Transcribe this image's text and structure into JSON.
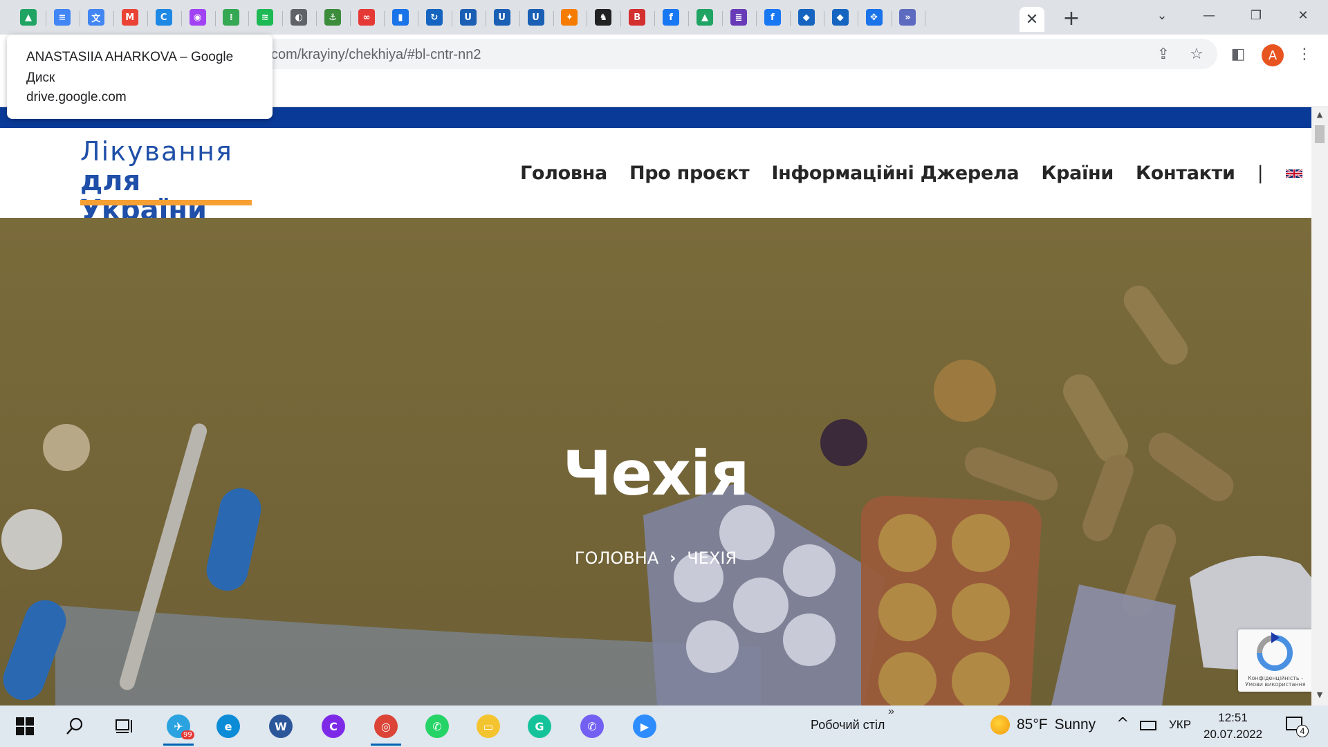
{
  "browser": {
    "tab_favicons": [
      {
        "icon": "google-drive-icon",
        "color": "#1fa463",
        "glyph": "▲"
      },
      {
        "icon": "google-docs-icon",
        "color": "#4285f4",
        "glyph": "≡"
      },
      {
        "icon": "google-translate-icon",
        "color": "#4285f4",
        "glyph": "文"
      },
      {
        "icon": "gmail-icon",
        "color": "#ea4335",
        "glyph": "M"
      },
      {
        "icon": "edge-refresh-icon",
        "color": "#1e88e5",
        "glyph": "C"
      },
      {
        "icon": "podcasts-icon",
        "color": "#a142f4",
        "glyph": "◉"
      },
      {
        "icon": "google-podcasts-icon",
        "color": "#34a853",
        "glyph": "⁞"
      },
      {
        "icon": "spotify-icon",
        "color": "#1db954",
        "glyph": "≋"
      },
      {
        "icon": "globe-icon",
        "color": "#5f6368",
        "glyph": "◐"
      },
      {
        "icon": "anchor-icon",
        "color": "#3c8c3c",
        "glyph": "⚓"
      },
      {
        "icon": "infinity-icon",
        "color": "#e53935",
        "glyph": "∞"
      },
      {
        "icon": "notebook-icon",
        "color": "#1a73e8",
        "glyph": "▮"
      },
      {
        "icon": "sync-icon",
        "color": "#1565c0",
        "glyph": "↻"
      },
      {
        "icon": "u-icon-1",
        "color": "#1a5fb4",
        "glyph": "U"
      },
      {
        "icon": "u-icon-2",
        "color": "#1a5fb4",
        "glyph": "U"
      },
      {
        "icon": "u-icon-3",
        "color": "#1a5fb4",
        "glyph": "U"
      },
      {
        "icon": "figure-icon",
        "color": "#f57c00",
        "glyph": "✦"
      },
      {
        "icon": "cat-icon",
        "color": "#222222",
        "glyph": "♞"
      },
      {
        "icon": "b-icon",
        "color": "#d32f2f",
        "glyph": "B"
      },
      {
        "icon": "facebook-icon",
        "color": "#1877f2",
        "glyph": "f"
      },
      {
        "icon": "google-drive-icon-2",
        "color": "#1fa463",
        "glyph": "▲"
      },
      {
        "icon": "forms-icon",
        "color": "#673ab7",
        "glyph": "≣"
      },
      {
        "icon": "facebook-icon-2",
        "color": "#1877f2",
        "glyph": "f"
      },
      {
        "icon": "shield-ua-icon",
        "color": "#1565c0",
        "glyph": "◆"
      },
      {
        "icon": "shield-ua-icon-2",
        "color": "#1565c0",
        "glyph": "◆"
      },
      {
        "icon": "move-icon",
        "color": "#1a73e8",
        "glyph": "✥"
      },
      {
        "icon": "double-chevron-icon",
        "color": "#5c6bc0",
        "glyph": "»"
      }
    ],
    "url": "com/krayiny/chekhiya/#bl-cntr-nn2",
    "tooltip": {
      "title": "ANASTASIIA AHARKOVA – Google Диск",
      "domain": "drive.google.com"
    },
    "avatar_letter": "A"
  },
  "site": {
    "logo": {
      "line1": "Лікування",
      "line2": "для України"
    },
    "nav": [
      "Головна",
      "Про проєкт",
      "Інформаційні Джерела",
      "Країни",
      "Контакти"
    ],
    "nav_separator": "|",
    "hero": {
      "title": "Чехія",
      "breadcrumb_home": "ГОЛОВНА",
      "breadcrumb_current": "ЧЕХІЯ"
    },
    "recaptcha_text": "Конфіденційність - Умови використання"
  },
  "taskbar": {
    "apps": [
      {
        "name": "telegram-icon",
        "color": "#2aa3e0",
        "glyph": "✈",
        "badge": "99"
      },
      {
        "name": "edge-icon",
        "color": "#0c8bd6",
        "glyph": "e"
      },
      {
        "name": "word-icon",
        "color": "#2b579a",
        "glyph": "W"
      },
      {
        "name": "canva-icon",
        "color": "#7d2ae8",
        "glyph": "C"
      },
      {
        "name": "chrome-icon",
        "color": "#db4437",
        "glyph": "◎"
      },
      {
        "name": "whatsapp-icon",
        "color": "#25d366",
        "glyph": "✆"
      },
      {
        "name": "file-explorer-icon",
        "color": "#f4c430",
        "glyph": "▭"
      },
      {
        "name": "grammarly-icon",
        "color": "#15c39a",
        "glyph": "G"
      },
      {
        "name": "viber-icon",
        "color": "#7360f2",
        "glyph": "✆"
      },
      {
        "name": "zoom-icon",
        "color": "#2d8cff",
        "glyph": "▶"
      }
    ],
    "desktop_label": "Робочий стіл",
    "weather": {
      "temp": "85°F",
      "condition": "Sunny"
    },
    "language": "УКР",
    "time": "12:51",
    "date": "20.07.2022",
    "notification_count": "4"
  }
}
